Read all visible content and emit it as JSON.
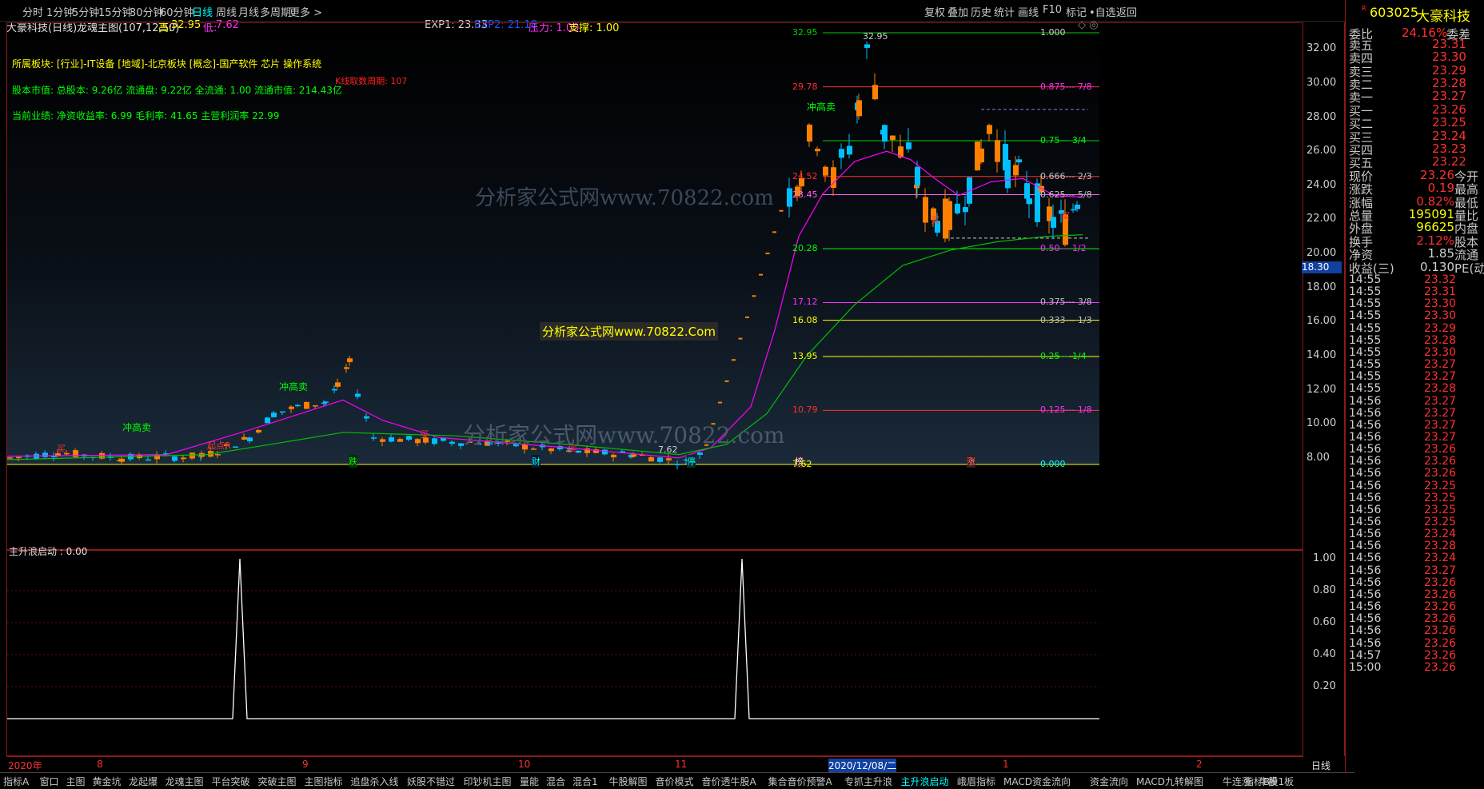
{
  "toolbar": {
    "items": [
      "分时",
      "1分钟",
      "5分钟",
      "15分钟",
      "30分钟",
      "60分钟",
      "日线",
      "周线",
      "月线",
      "多周期",
      "更多 >"
    ],
    "active": "日线",
    "right": [
      "复权",
      "叠加",
      "历史",
      "统计",
      "画线",
      "F10",
      "标记",
      "•自选",
      "返回"
    ]
  },
  "title_bar": {
    "name": "大豪科技(日线)",
    "indicator": "龙魂主图(107,12,50)",
    "high_label": "高:",
    "high": "32.95",
    "low_label": "低:",
    "low": "7.62",
    "exp1": "EXP1: 23.33",
    "exp2": "EXP2: 21.18",
    "pressure": "压力: 1.00",
    "support": "支撑: 1.00"
  },
  "info": {
    "sector": "所属板块: [行业]-IT设备 [地域]-北京板块 [概念]-国产软件 芯片 操作系统",
    "cap": "股本市值: 总股本: 9.26亿 流通盘: 9.22亿 全流通: 1.00 流通市值: 214.43亿",
    "perf": "当前业绩: 净资收益率: 6.99 毛利率: 41.65 主营利润率 22.99",
    "kline_period": "K线取数周期: 107"
  },
  "watermarks": [
    "分析家公式网www.70822.com",
    "分析家公式网www.70822.Com",
    "分析家公式网www.70822.com"
  ],
  "chart_labels": {
    "high_mark": "32.95",
    "low_mark": "7.62",
    "signals": [
      "冲高卖",
      "冲高卖",
      "冲高卖",
      "起点R",
      "买",
      "买",
      "买",
      "买",
      "买",
      "跌",
      "财",
      "停",
      "榜",
      "涨"
    ]
  },
  "fib_levels": [
    {
      "price": "32.95",
      "frac": "1.000",
      "pcolor": "#00d000",
      "fcolor": "#d0d0d0"
    },
    {
      "price": "29.78",
      "frac": "0.875--- 7/8",
      "pcolor": "#ff3030",
      "fcolor": "#ff30ff"
    },
    {
      "price": "",
      "frac": "0.75--- 3/4",
      "pcolor": "#00d000",
      "fcolor": "#00ff00"
    },
    {
      "price": "24.52",
      "frac": "0.666--- 2/3",
      "pcolor": "#ff3030",
      "fcolor": "#c0c0c0"
    },
    {
      "price": "23.45",
      "frac": "0.625--- 5/8",
      "pcolor": "#ff60ff",
      "fcolor": "#c0c0c0"
    },
    {
      "price": "20.28",
      "frac": "0.50--- 1/2",
      "pcolor": "#00ff00",
      "fcolor": "#ff30ff"
    },
    {
      "price": "17.12",
      "frac": "0.375--- 3/8",
      "pcolor": "#ff30ff",
      "fcolor": "#c0c0c0"
    },
    {
      "price": "16.08",
      "frac": "0.333--- 1/3",
      "pcolor": "#ffff00",
      "fcolor": "#c0c0c0"
    },
    {
      "price": "13.95",
      "frac": "0.25--- 1/4",
      "pcolor": "#ffff00",
      "fcolor": "#00ff00"
    },
    {
      "price": "10.79",
      "frac": "0.125--- 1/8",
      "pcolor": "#ff3030",
      "fcolor": "#ff30ff"
    },
    {
      "price": "7.62",
      "frac": "0.000",
      "pcolor": "#ffff00",
      "fcolor": "#00ffff"
    }
  ],
  "price_axis": [
    "32.00",
    "30.00",
    "28.00",
    "26.00",
    "24.00",
    "22.00",
    "20.00",
    "18.00",
    "16.00",
    "14.00",
    "12.00",
    "10.00",
    "8.00"
  ],
  "axis_marker": "18.30",
  "sub_indicator": {
    "title": "主升浪启动 : 0.00",
    "axis": [
      "1.00",
      "0.80",
      "0.60",
      "0.40",
      "0.20"
    ]
  },
  "date_axis": [
    "2020年",
    "8",
    "9",
    "10",
    "11",
    "2020/12/08/二",
    "1",
    "2"
  ],
  "period_label": "日线",
  "quote": {
    "code": "603025",
    "name": "大豪科技",
    "weibi_label": "委比",
    "weibi": "24.16%",
    "weicha_label": "委差",
    "sell": [
      {
        "l": "卖五",
        "p": "23.31"
      },
      {
        "l": "卖四",
        "p": "23.30"
      },
      {
        "l": "卖三",
        "p": "23.29"
      },
      {
        "l": "卖二",
        "p": "23.28"
      },
      {
        "l": "卖一",
        "p": "23.27"
      }
    ],
    "buy": [
      {
        "l": "买一",
        "p": "23.26"
      },
      {
        "l": "买二",
        "p": "23.25"
      },
      {
        "l": "买三",
        "p": "23.24"
      },
      {
        "l": "买四",
        "p": "23.23"
      },
      {
        "l": "买五",
        "p": "23.22"
      }
    ],
    "stats": [
      {
        "l": "现价",
        "v": "23.26",
        "r": "今开"
      },
      {
        "l": "涨跌",
        "v": "0.19",
        "r": "最高"
      },
      {
        "l": "涨幅",
        "v": "0.82%",
        "r": "最低"
      },
      {
        "l": "总量",
        "v": "195091",
        "r": "量比"
      },
      {
        "l": "外盘",
        "v": "96625",
        "r": "内盘"
      }
    ],
    "stats2": [
      {
        "l": "换手",
        "v": "2.12%",
        "r": "股本"
      },
      {
        "l": "净资",
        "v": "1.85",
        "r": "流通"
      },
      {
        "l": "收益(三)",
        "v": "0.130",
        "r": "PE(动)"
      }
    ],
    "ticks": [
      {
        "t": "14:55",
        "p": "23.32"
      },
      {
        "t": "14:55",
        "p": "23.31"
      },
      {
        "t": "14:55",
        "p": "23.30"
      },
      {
        "t": "14:55",
        "p": "23.30"
      },
      {
        "t": "14:55",
        "p": "23.29"
      },
      {
        "t": "14:55",
        "p": "23.28"
      },
      {
        "t": "14:55",
        "p": "23.30"
      },
      {
        "t": "14:55",
        "p": "23.27"
      },
      {
        "t": "14:55",
        "p": "23.27"
      },
      {
        "t": "14:55",
        "p": "23.28"
      },
      {
        "t": "14:56",
        "p": "23.27"
      },
      {
        "t": "14:56",
        "p": "23.27"
      },
      {
        "t": "14:56",
        "p": "23.27"
      },
      {
        "t": "14:56",
        "p": "23.27"
      },
      {
        "t": "14:56",
        "p": "23.26"
      },
      {
        "t": "14:56",
        "p": "23.26"
      },
      {
        "t": "14:56",
        "p": "23.26"
      },
      {
        "t": "14:56",
        "p": "23.25"
      },
      {
        "t": "14:56",
        "p": "23.25"
      },
      {
        "t": "14:56",
        "p": "23.25"
      },
      {
        "t": "14:56",
        "p": "23.25"
      },
      {
        "t": "14:56",
        "p": "23.24"
      },
      {
        "t": "14:56",
        "p": "23.28"
      },
      {
        "t": "14:56",
        "p": "23.24"
      },
      {
        "t": "14:56",
        "p": "23.27"
      },
      {
        "t": "14:56",
        "p": "23.26"
      },
      {
        "t": "14:56",
        "p": "23.26"
      },
      {
        "t": "14:56",
        "p": "23.26"
      },
      {
        "t": "14:56",
        "p": "23.26"
      },
      {
        "t": "14:56",
        "p": "23.26"
      },
      {
        "t": "14:56",
        "p": "23.26"
      },
      {
        "t": "14:57",
        "p": "23.26"
      },
      {
        "t": "15:00",
        "p": "23.26"
      }
    ]
  },
  "bottom_tabs": [
    "指标A",
    "窗口",
    "主图",
    "黄金坑",
    "龙起爆",
    "龙魂主图",
    "平台突破",
    "突破主图",
    "主图指标",
    "追盘杀入线",
    "妖股不错过",
    "印钞机主图",
    "量能",
    "混合",
    "混合1",
    "牛股解图",
    "音价模式",
    "音价透牛股A",
    "集合音价预警A",
    "专抓主升浪",
    "主升浪启动",
    "峨眉指标",
    "MACD资金流向",
    "资金流向",
    "MACD九转解图",
    "牛连涨",
    "牛股1"
  ],
  "bottom_active": "主升浪启动",
  "bottom_right": [
    "指标B",
    "模",
    "板"
  ],
  "colors": {
    "up": "#ff8000",
    "down": "#00c0ff",
    "frame": "#8b1a1a",
    "ma_fast": "#ff00ff",
    "ma_slow": "#00c000"
  }
}
